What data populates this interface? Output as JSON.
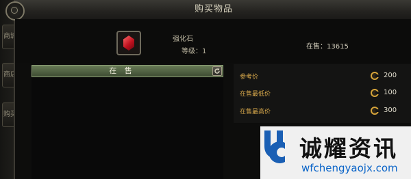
{
  "window": {
    "title": "购买物品"
  },
  "background": {
    "tabs": [
      "商城",
      "商店",
      "购买"
    ]
  },
  "item": {
    "icon": "red-gem-icon",
    "name": "强化石",
    "level": "等级：1",
    "sale_count": "在售：13615"
  },
  "on_sale": {
    "header": "在 售",
    "refresh_icon": "refresh-icon"
  },
  "prices": [
    {
      "label": "参考价",
      "value": "200",
      "icon": "coin-icon"
    },
    {
      "label": "在售最低价",
      "value": "100",
      "icon": "coin-icon"
    },
    {
      "label": "在售最高价",
      "value": "300",
      "icon": "coin-icon"
    }
  ],
  "colors": {
    "accent_green": "#677a55",
    "price_label": "#d7a84b",
    "coin": "#d6a43a"
  },
  "watermark": {
    "name": "诚耀资讯",
    "url": "wfchengyaojx.com",
    "logo_color": "#1a5fb4"
  }
}
